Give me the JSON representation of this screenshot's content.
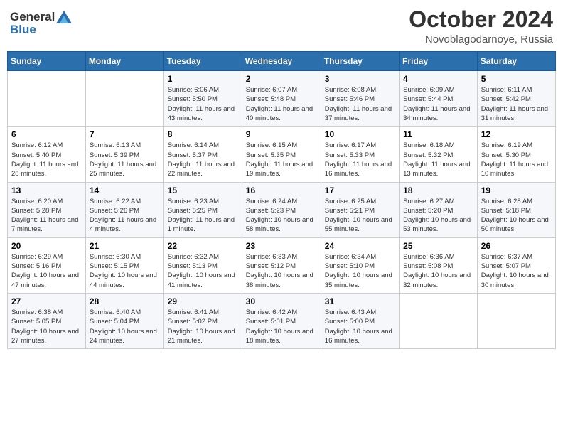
{
  "logo": {
    "general": "General",
    "blue": "Blue"
  },
  "title": "October 2024",
  "location": "Novoblagodarnoye, Russia",
  "days_header": [
    "Sunday",
    "Monday",
    "Tuesday",
    "Wednesday",
    "Thursday",
    "Friday",
    "Saturday"
  ],
  "weeks": [
    [
      {
        "day": "",
        "sunrise": "",
        "sunset": "",
        "daylight": ""
      },
      {
        "day": "",
        "sunrise": "",
        "sunset": "",
        "daylight": ""
      },
      {
        "day": "1",
        "sunrise": "Sunrise: 6:06 AM",
        "sunset": "Sunset: 5:50 PM",
        "daylight": "Daylight: 11 hours and 43 minutes."
      },
      {
        "day": "2",
        "sunrise": "Sunrise: 6:07 AM",
        "sunset": "Sunset: 5:48 PM",
        "daylight": "Daylight: 11 hours and 40 minutes."
      },
      {
        "day": "3",
        "sunrise": "Sunrise: 6:08 AM",
        "sunset": "Sunset: 5:46 PM",
        "daylight": "Daylight: 11 hours and 37 minutes."
      },
      {
        "day": "4",
        "sunrise": "Sunrise: 6:09 AM",
        "sunset": "Sunset: 5:44 PM",
        "daylight": "Daylight: 11 hours and 34 minutes."
      },
      {
        "day": "5",
        "sunrise": "Sunrise: 6:11 AM",
        "sunset": "Sunset: 5:42 PM",
        "daylight": "Daylight: 11 hours and 31 minutes."
      }
    ],
    [
      {
        "day": "6",
        "sunrise": "Sunrise: 6:12 AM",
        "sunset": "Sunset: 5:40 PM",
        "daylight": "Daylight: 11 hours and 28 minutes."
      },
      {
        "day": "7",
        "sunrise": "Sunrise: 6:13 AM",
        "sunset": "Sunset: 5:39 PM",
        "daylight": "Daylight: 11 hours and 25 minutes."
      },
      {
        "day": "8",
        "sunrise": "Sunrise: 6:14 AM",
        "sunset": "Sunset: 5:37 PM",
        "daylight": "Daylight: 11 hours and 22 minutes."
      },
      {
        "day": "9",
        "sunrise": "Sunrise: 6:15 AM",
        "sunset": "Sunset: 5:35 PM",
        "daylight": "Daylight: 11 hours and 19 minutes."
      },
      {
        "day": "10",
        "sunrise": "Sunrise: 6:17 AM",
        "sunset": "Sunset: 5:33 PM",
        "daylight": "Daylight: 11 hours and 16 minutes."
      },
      {
        "day": "11",
        "sunrise": "Sunrise: 6:18 AM",
        "sunset": "Sunset: 5:32 PM",
        "daylight": "Daylight: 11 hours and 13 minutes."
      },
      {
        "day": "12",
        "sunrise": "Sunrise: 6:19 AM",
        "sunset": "Sunset: 5:30 PM",
        "daylight": "Daylight: 11 hours and 10 minutes."
      }
    ],
    [
      {
        "day": "13",
        "sunrise": "Sunrise: 6:20 AM",
        "sunset": "Sunset: 5:28 PM",
        "daylight": "Daylight: 11 hours and 7 minutes."
      },
      {
        "day": "14",
        "sunrise": "Sunrise: 6:22 AM",
        "sunset": "Sunset: 5:26 PM",
        "daylight": "Daylight: 11 hours and 4 minutes."
      },
      {
        "day": "15",
        "sunrise": "Sunrise: 6:23 AM",
        "sunset": "Sunset: 5:25 PM",
        "daylight": "Daylight: 11 hours and 1 minute."
      },
      {
        "day": "16",
        "sunrise": "Sunrise: 6:24 AM",
        "sunset": "Sunset: 5:23 PM",
        "daylight": "Daylight: 10 hours and 58 minutes."
      },
      {
        "day": "17",
        "sunrise": "Sunrise: 6:25 AM",
        "sunset": "Sunset: 5:21 PM",
        "daylight": "Daylight: 10 hours and 55 minutes."
      },
      {
        "day": "18",
        "sunrise": "Sunrise: 6:27 AM",
        "sunset": "Sunset: 5:20 PM",
        "daylight": "Daylight: 10 hours and 53 minutes."
      },
      {
        "day": "19",
        "sunrise": "Sunrise: 6:28 AM",
        "sunset": "Sunset: 5:18 PM",
        "daylight": "Daylight: 10 hours and 50 minutes."
      }
    ],
    [
      {
        "day": "20",
        "sunrise": "Sunrise: 6:29 AM",
        "sunset": "Sunset: 5:16 PM",
        "daylight": "Daylight: 10 hours and 47 minutes."
      },
      {
        "day": "21",
        "sunrise": "Sunrise: 6:30 AM",
        "sunset": "Sunset: 5:15 PM",
        "daylight": "Daylight: 10 hours and 44 minutes."
      },
      {
        "day": "22",
        "sunrise": "Sunrise: 6:32 AM",
        "sunset": "Sunset: 5:13 PM",
        "daylight": "Daylight: 10 hours and 41 minutes."
      },
      {
        "day": "23",
        "sunrise": "Sunrise: 6:33 AM",
        "sunset": "Sunset: 5:12 PM",
        "daylight": "Daylight: 10 hours and 38 minutes."
      },
      {
        "day": "24",
        "sunrise": "Sunrise: 6:34 AM",
        "sunset": "Sunset: 5:10 PM",
        "daylight": "Daylight: 10 hours and 35 minutes."
      },
      {
        "day": "25",
        "sunrise": "Sunrise: 6:36 AM",
        "sunset": "Sunset: 5:08 PM",
        "daylight": "Daylight: 10 hours and 32 minutes."
      },
      {
        "day": "26",
        "sunrise": "Sunrise: 6:37 AM",
        "sunset": "Sunset: 5:07 PM",
        "daylight": "Daylight: 10 hours and 30 minutes."
      }
    ],
    [
      {
        "day": "27",
        "sunrise": "Sunrise: 6:38 AM",
        "sunset": "Sunset: 5:05 PM",
        "daylight": "Daylight: 10 hours and 27 minutes."
      },
      {
        "day": "28",
        "sunrise": "Sunrise: 6:40 AM",
        "sunset": "Sunset: 5:04 PM",
        "daylight": "Daylight: 10 hours and 24 minutes."
      },
      {
        "day": "29",
        "sunrise": "Sunrise: 6:41 AM",
        "sunset": "Sunset: 5:02 PM",
        "daylight": "Daylight: 10 hours and 21 minutes."
      },
      {
        "day": "30",
        "sunrise": "Sunrise: 6:42 AM",
        "sunset": "Sunset: 5:01 PM",
        "daylight": "Daylight: 10 hours and 18 minutes."
      },
      {
        "day": "31",
        "sunrise": "Sunrise: 6:43 AM",
        "sunset": "Sunset: 5:00 PM",
        "daylight": "Daylight: 10 hours and 16 minutes."
      },
      {
        "day": "",
        "sunrise": "",
        "sunset": "",
        "daylight": ""
      },
      {
        "day": "",
        "sunrise": "",
        "sunset": "",
        "daylight": ""
      }
    ]
  ]
}
